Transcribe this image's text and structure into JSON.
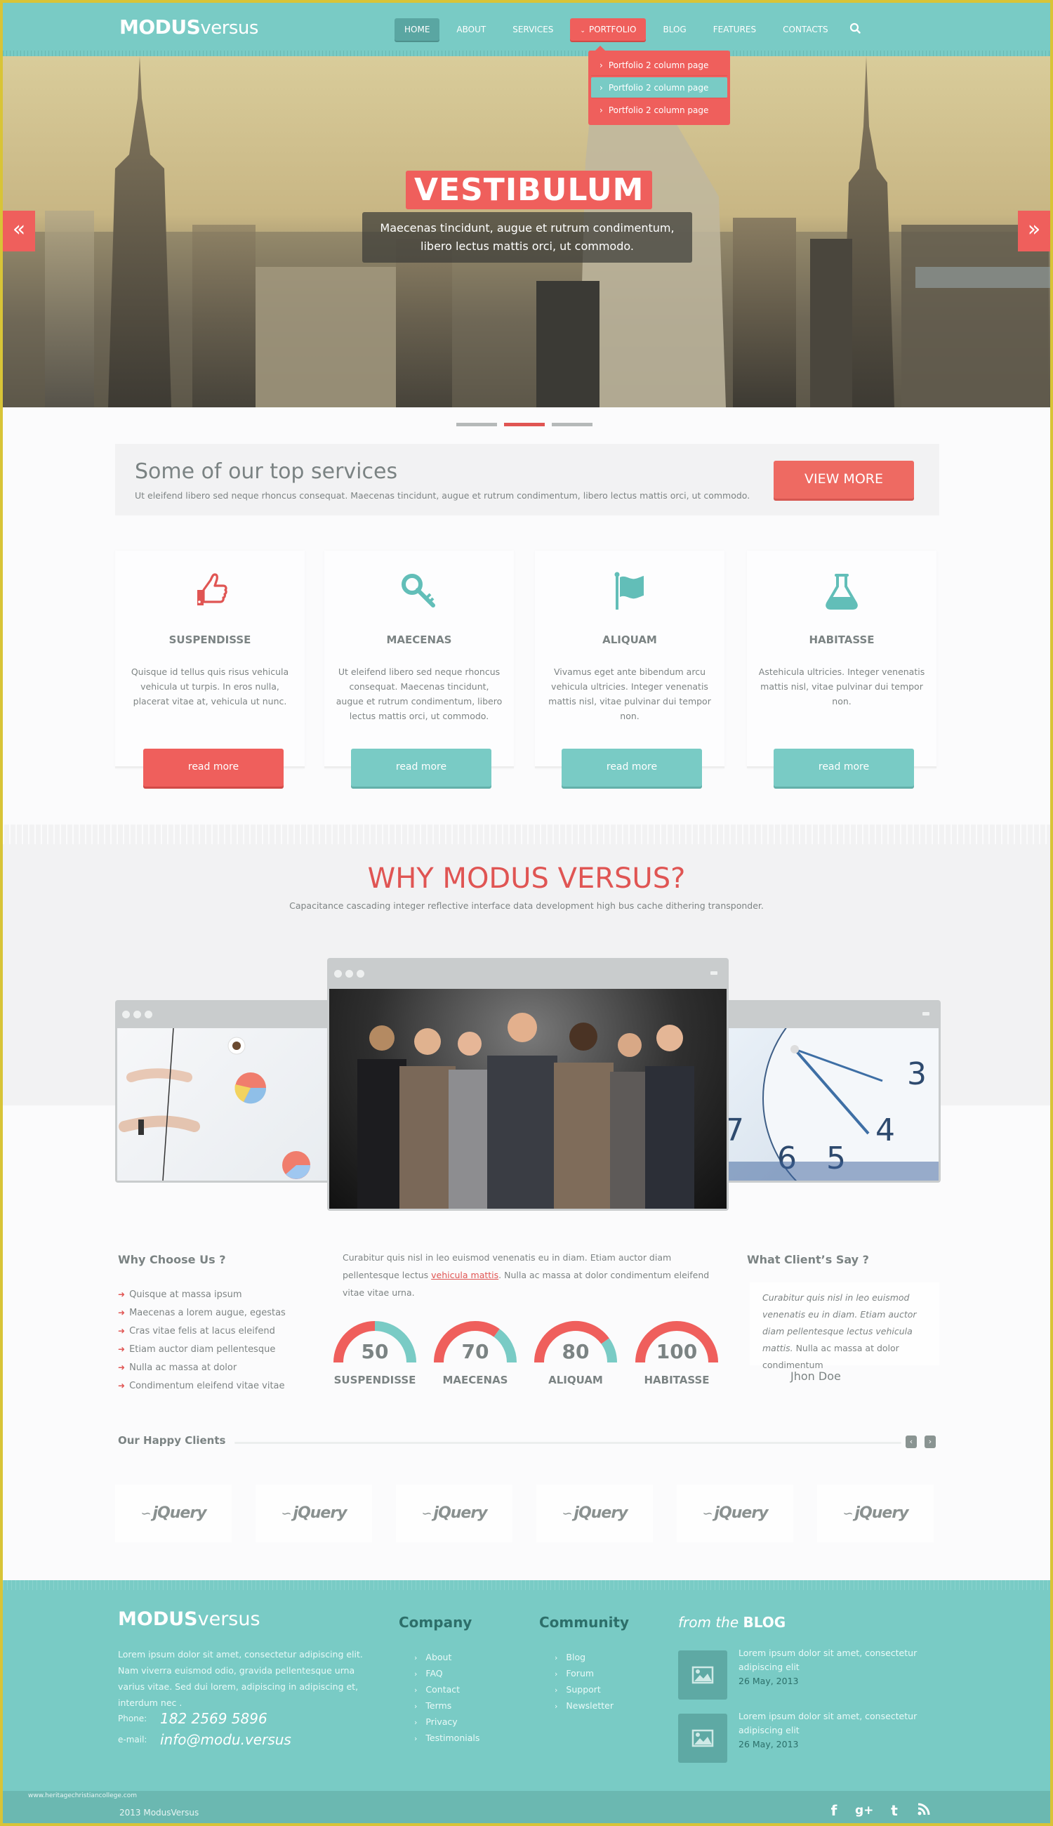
{
  "header": {
    "logo_bold": "MODUS",
    "logo_light": "versus",
    "nav": [
      "HOME",
      "ABOUT",
      "SERVICES",
      "PORTFOLIO",
      "BLOG",
      "FEATURES",
      "CONTACTS"
    ],
    "active_nav": "HOME",
    "open_nav": "PORTFOLIO",
    "dropdown": [
      "Portfolio 2 column page",
      "Portfolio 2 column page",
      "Portfolio 2 column page"
    ],
    "dropdown_highlighted_index": 1
  },
  "hero": {
    "title": "VESTIBULUM",
    "caption_line1": "Maecenas tincidunt, augue et rutrum condimentum,",
    "caption_line2": "libero lectus mattis orci, ut commodo.",
    "prev_icon": "«",
    "next_icon": "»",
    "slide_count": 3,
    "active_slide": 2
  },
  "services_bar": {
    "title": "Some of our top services",
    "text": "Ut eleifend libero sed neque rhoncus consequat. Maecenas tincidunt, augue et rutrum condimentum, libero lectus mattis orci, ut commodo.",
    "button": "VIEW MORE"
  },
  "cards": [
    {
      "icon": "thumbs-up-icon",
      "title": "SUSPENDISSE",
      "text": "Quisque id tellus quis risus vehicula vehicula ut turpis. In eros nulla, placerat vitae at, vehicula ut nunc.",
      "button": "read more",
      "color": "red"
    },
    {
      "icon": "key-icon",
      "title": "MAECENAS",
      "text": "Ut eleifend libero sed neque rhoncus consequat. Maecenas tincidunt, augue et rutrum condimentum, libero lectus mattis orci, ut commodo.",
      "button": "read more",
      "color": "teal"
    },
    {
      "icon": "flag-icon",
      "title": "ALIQUAM",
      "text": "Vivamus eget ante bibendum arcu vehicula ultricies. Integer venenatis mattis nisl, vitae pulvinar dui tempor non.",
      "button": "read more",
      "color": "teal"
    },
    {
      "icon": "flask-icon",
      "title": "HABITASSE",
      "text": "Astehicula ultricies. Integer venenatis mattis nisl, vitae pulvinar dui tempor non.",
      "button": "read more",
      "color": "teal"
    }
  ],
  "why": {
    "title": "WHY MODUS VERSUS?",
    "subtitle": "Capacitance cascading integer reflective interface data development high bus cache dithering transponder."
  },
  "choose": {
    "title": "Why Choose Us ?",
    "items": [
      "Quisque at massa ipsum",
      "Maecenas a lorem augue, egestas",
      "Cras vitae felis at lacus eleifend",
      "Etiam auctor diam pellentesque",
      "Nulla ac massa at dolor",
      "Condimentum eleifend vitae vitae"
    ]
  },
  "mid": {
    "text_before": "Curabitur quis nisl in leo euismod venenatis eu in diam. Etiam auctor diam pellentesque lectus ",
    "link": "vehicula mattis",
    "text_after": ". Nulla ac massa at dolor condimentum eleifend vitae vitae urna."
  },
  "gauges": [
    {
      "label": "SUSPENDISSE",
      "value": 50
    },
    {
      "label": "MAECENAS",
      "value": 70
    },
    {
      "label": "ALIQUAM",
      "value": 80
    },
    {
      "label": "HABITASSE",
      "value": 100
    }
  ],
  "testimonial": {
    "title": "What Client’s Say ?",
    "quote_italic": "Curabitur quis nisl in leo euismod venenatis eu in diam. Etiam auctor diam pellentesque lectus vehicula mattis.",
    "quote_normal": " Nulla ac massa at dolor condimentum",
    "author": "Jhon Doe"
  },
  "clients": {
    "title": "Our Happy Clients",
    "prev": "‹",
    "next": "›",
    "logos": [
      "jQuery",
      "jQuery",
      "jQuery",
      "jQuery",
      "jQuery",
      "jQuery"
    ]
  },
  "footer": {
    "logo_bold": "MODUS",
    "logo_light": "versus",
    "text": "Lorem ipsum dolor sit amet, consectetur adipiscing elit. Nam viverra euismod odio, gravida pellentesque urna varius vitae. Sed dui lorem, adipiscing in adipiscing et, interdum nec .",
    "phone_label": "Phone:",
    "phone": "182 2569 5896",
    "email_label": "e-mail:",
    "email": "info@modu.versus",
    "company_title": "Company",
    "company_links": [
      "About",
      "FAQ",
      "Contact",
      "Terms",
      "Privacy",
      "Testimonials"
    ],
    "community_title": "Community",
    "community_links": [
      "Blog",
      "Forum",
      "Support",
      "Newsletter"
    ],
    "blog_title_italic": "from the",
    "blog_title_bold": "BLOG",
    "blog_posts": [
      {
        "title": "Lorem ipsum dolor sit amet, consectetur adipiscing elit",
        "date": "26 May, 2013"
      },
      {
        "title": "Lorem ipsum dolor sit amet, consectetur adipiscing elit",
        "date": "26 May, 2013"
      }
    ],
    "credit": "www.heritagechristiancollege.com",
    "copyright": "2013  ModusVersus",
    "social": [
      "facebook-icon",
      "google-plus-icon",
      "twitter-icon",
      "rss-icon"
    ]
  },
  "colors": {
    "teal": "#79cbc5",
    "red": "#ef5f5c",
    "text_gray": "#7b8383"
  }
}
